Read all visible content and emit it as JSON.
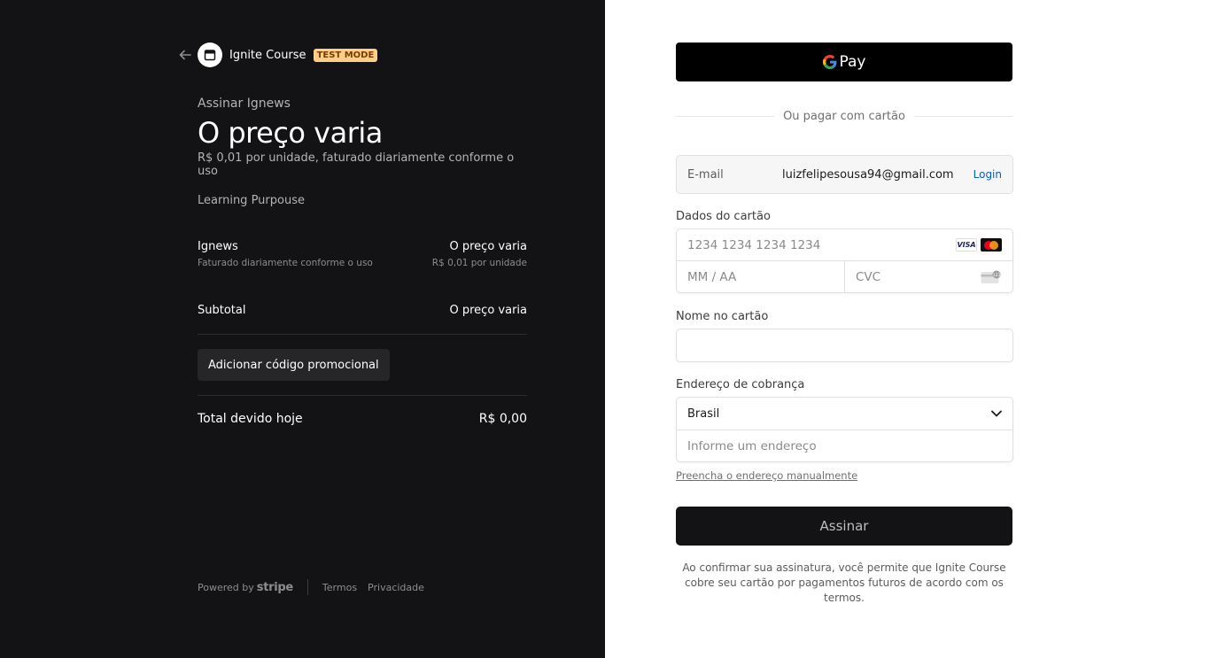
{
  "merchant": {
    "name": "Ignite Course",
    "badge": "TEST MODE"
  },
  "product": {
    "subscribe_title": "Assinar Ignews",
    "price": "O preço varia",
    "price_description": "R$ 0,01 por unidade, faturado diariamente conforme o uso",
    "description": "Learning Purpouse"
  },
  "line_item": {
    "name": "Ignews",
    "amount": "O preço varia",
    "subtitle": "Faturado diariamente conforme o uso",
    "unit_price": "R$ 0,01 por unidade"
  },
  "summary": {
    "subtotal_label": "Subtotal",
    "subtotal_value": "O preço varia",
    "promo_label": "Adicionar código promocional",
    "total_label": "Total devido hoje",
    "total_value": "R$ 0,00"
  },
  "footer": {
    "powered_by": "Powered by",
    "brand": "stripe",
    "terms": "Termos",
    "privacy": "Privacidade"
  },
  "payment": {
    "gpay_label": "Pay",
    "divider_text": "Ou pagar com cartão",
    "email_label": "E-mail",
    "email_value": "luizfelipesousa94@gmail.com",
    "login_label": "Login",
    "card_label": "Dados do cartão",
    "card_number_placeholder": "1234 1234 1234 1234",
    "expiry_placeholder": "MM / AA",
    "cvc_placeholder": "CVC",
    "card_brand_visa": "VISA",
    "name_label": "Nome no cartão",
    "name_value": "",
    "address_label": "Endereço de cobrança",
    "country_value": "Brasil",
    "address_placeholder": "Informe um endereço",
    "manual_address_link": "Preencha o endereço manualmente",
    "submit_label": "Assinar",
    "terms_text": "Ao confirmar sua assinatura, você permite que Ignite Course cobre seu cartão por pagamentos futuros de acordo com os termos."
  },
  "icons": {
    "back": "arrow-left-icon",
    "merchant_logo": "store-icon",
    "google": "google-g-icon",
    "visa": "visa-icon",
    "mastercard": "mastercard-icon",
    "cvc": "card-cvc-icon",
    "chevron": "chevron-down-icon"
  },
  "colors": {
    "left_bg": "#131214",
    "badge_bg": "#ffcf86",
    "login_link": "#0a5dc2",
    "submit_bg": "#131214"
  }
}
